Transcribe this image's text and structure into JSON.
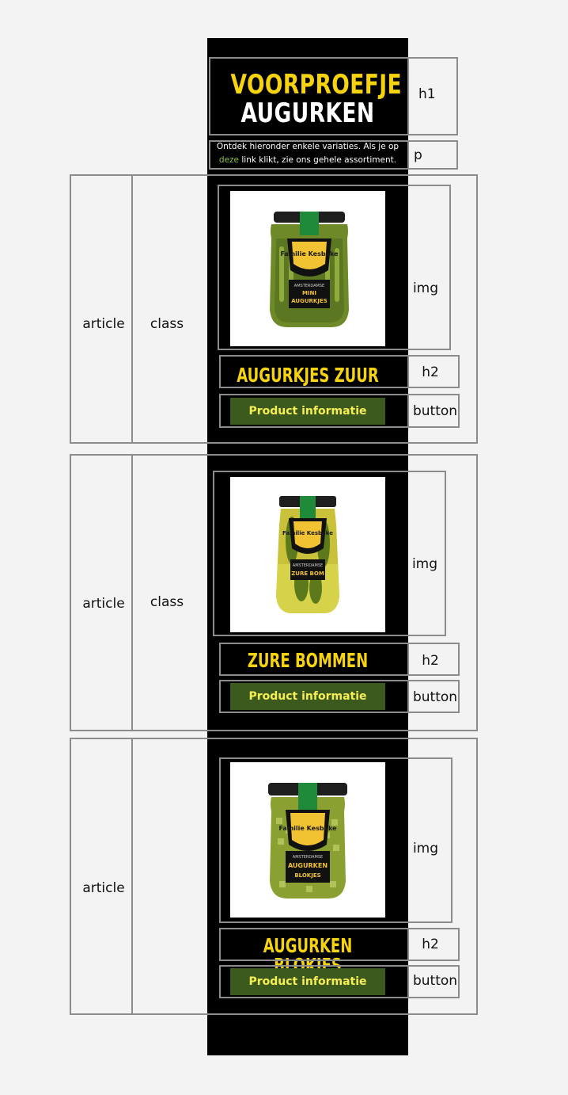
{
  "page": {
    "title_line1": "VOORPROEFJE",
    "title_line2": "AUGURKEN",
    "intro_before": "Ontdek hieronder enkele variaties. Als je op",
    "intro_link": "deze",
    "intro_after": "link klikt, zie ons gehele assortiment."
  },
  "labels": {
    "h1": "h1",
    "p": "p",
    "article": "article",
    "class": "class",
    "img": "img",
    "h2": "h2",
    "button": "button"
  },
  "products": [
    {
      "name": "AUGURKJES ZUUR",
      "button": "Product informatie",
      "jar_brand": "Familie Kesbeke",
      "jar_sub": "AMSTERDAMSE",
      "jar_line1": "MINI",
      "jar_line2": "AUGURKJES"
    },
    {
      "name": "ZURE BOMMEN",
      "button": "Product informatie",
      "jar_brand": "Familie Kesbeke",
      "jar_sub": "AMSTERDAMSE",
      "jar_line1": "ZURE BOM",
      "jar_line2": ""
    },
    {
      "name": "AUGURKEN BLOKJES",
      "button": "Product informatie",
      "jar_brand": "Familie Kesbeke",
      "jar_sub": "AMSTERDAMSE",
      "jar_line1": "AUGURKEN",
      "jar_line2": "BLOKJES"
    }
  ]
}
